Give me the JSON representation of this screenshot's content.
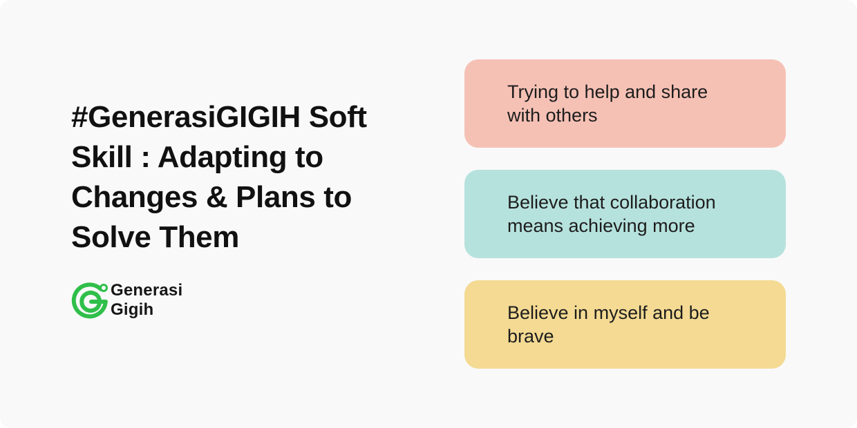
{
  "title": "#GenerasiGIGIH Soft Skill : Adapting to Changes & Plans to Solve Them",
  "logo": {
    "icon": "generasi-gigih-logo-icon",
    "line1": "Generasi",
    "line2": "Gigih",
    "color": "#2fbf4a"
  },
  "cards": [
    {
      "text": "Trying to help and share with others",
      "color": "#f6c1b5"
    },
    {
      "text": "Believe that collaboration means achieving more",
      "color": "#b6e2dd"
    },
    {
      "text": "Believe in myself and be brave",
      "color": "#f4da93"
    }
  ]
}
